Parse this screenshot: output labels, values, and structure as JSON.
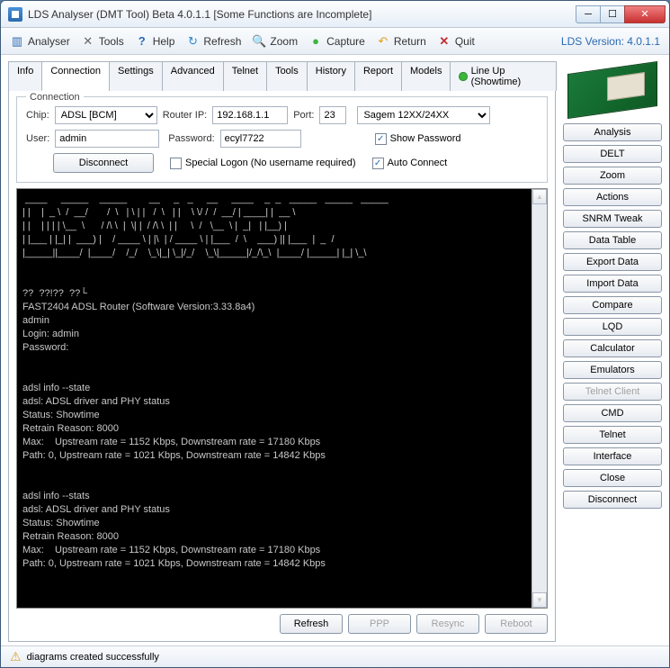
{
  "title": "LDS Analyser (DMT Tool) Beta 4.0.1.1 [Some Functions are Incomplete]",
  "version_label": "LDS Version: 4.0.1.1",
  "toolbar": {
    "analyser": "Analyser",
    "tools": "Tools",
    "help": "Help",
    "refresh": "Refresh",
    "zoom": "Zoom",
    "capture": "Capture",
    "return": "Return",
    "quit": "Quit"
  },
  "tabs": {
    "info": "Info",
    "connection": "Connection",
    "settings": "Settings",
    "advanced": "Advanced",
    "telnet": "Telnet",
    "tools": "Tools",
    "history": "History",
    "report": "Report",
    "models": "Models",
    "lineup": "Line Up (Showtime)"
  },
  "connection": {
    "legend": "Connection",
    "chip_label": "Chip:",
    "chip_value": "ADSL [BCM]",
    "router_ip_label": "Router IP:",
    "router_ip_value": "192.168.1.1",
    "port_label": "Port:",
    "port_value": "23",
    "model_value": "Sagem 12XX/24XX",
    "user_label": "User:",
    "user_value": "admin",
    "password_label": "Password:",
    "password_value": "ecyl7722",
    "show_password": "Show Password",
    "disconnect": "Disconnect",
    "special_logon": "Special Logon (No username required)",
    "auto_connect": "Auto Connect"
  },
  "terminal_text": " ____     _____    _____        __     _   _     __     ____    _  _   _____   _____   _____\n| |    |  _ \\  /  __/       /  \\   | \\ | |   /  \\   | |    \\ \\/ /  /  __/ | ____| |  __ \\\n| |    | | | | \\__  \\      / /\\ \\  |  \\| |  / /\\ \\  | |     \\  /   \\__  \\ |  _|   | |__) |\n| |___ | |_| |  ___) |    / ____ \\ | |\\  | / ____ \\ | |___  /  \\    ___) || |___  |  _  /\n|_____||____/  |____/    /_/    \\_\\|_| \\_|/_/    \\_\\|_____|/_/\\_\\  |____/ |_____| |_| \\_\\\n\n\n??  ??!??  ??└\nFAST2404 ADSL Router (Software Version:3.33.8a4)\nadmin\nLogin: admin\nPassword:\n\n\nadsl info --state\nadsl: ADSL driver and PHY status\nStatus: Showtime\nRetrain Reason: 8000\nMax:    Upstream rate = 1152 Kbps, Downstream rate = 17180 Kbps\nPath: 0, Upstream rate = 1021 Kbps, Downstream rate = 14842 Kbps\n\n\nadsl info --stats\nadsl: ADSL driver and PHY status\nStatus: Showtime\nRetrain Reason: 8000\nMax:    Upstream rate = 1152 Kbps, Downstream rate = 17180 Kbps\nPath: 0, Upstream rate = 1021 Kbps, Downstream rate = 14842 Kbps",
  "bottom_actions": {
    "refresh": "Refresh",
    "ppp": "PPP",
    "resync": "Resync",
    "reboot": "Reboot"
  },
  "side_buttons": [
    "Analysis",
    "DELT",
    "Zoom",
    "Actions",
    "SNRM Tweak",
    "Data Table",
    "Export Data",
    "Import Data",
    "Compare",
    "LQD",
    "Calculator",
    "Emulators",
    "Telnet Client",
    "CMD",
    "Telnet",
    "Interface",
    "Close",
    "Disconnect"
  ],
  "status": "diagrams created successfully"
}
